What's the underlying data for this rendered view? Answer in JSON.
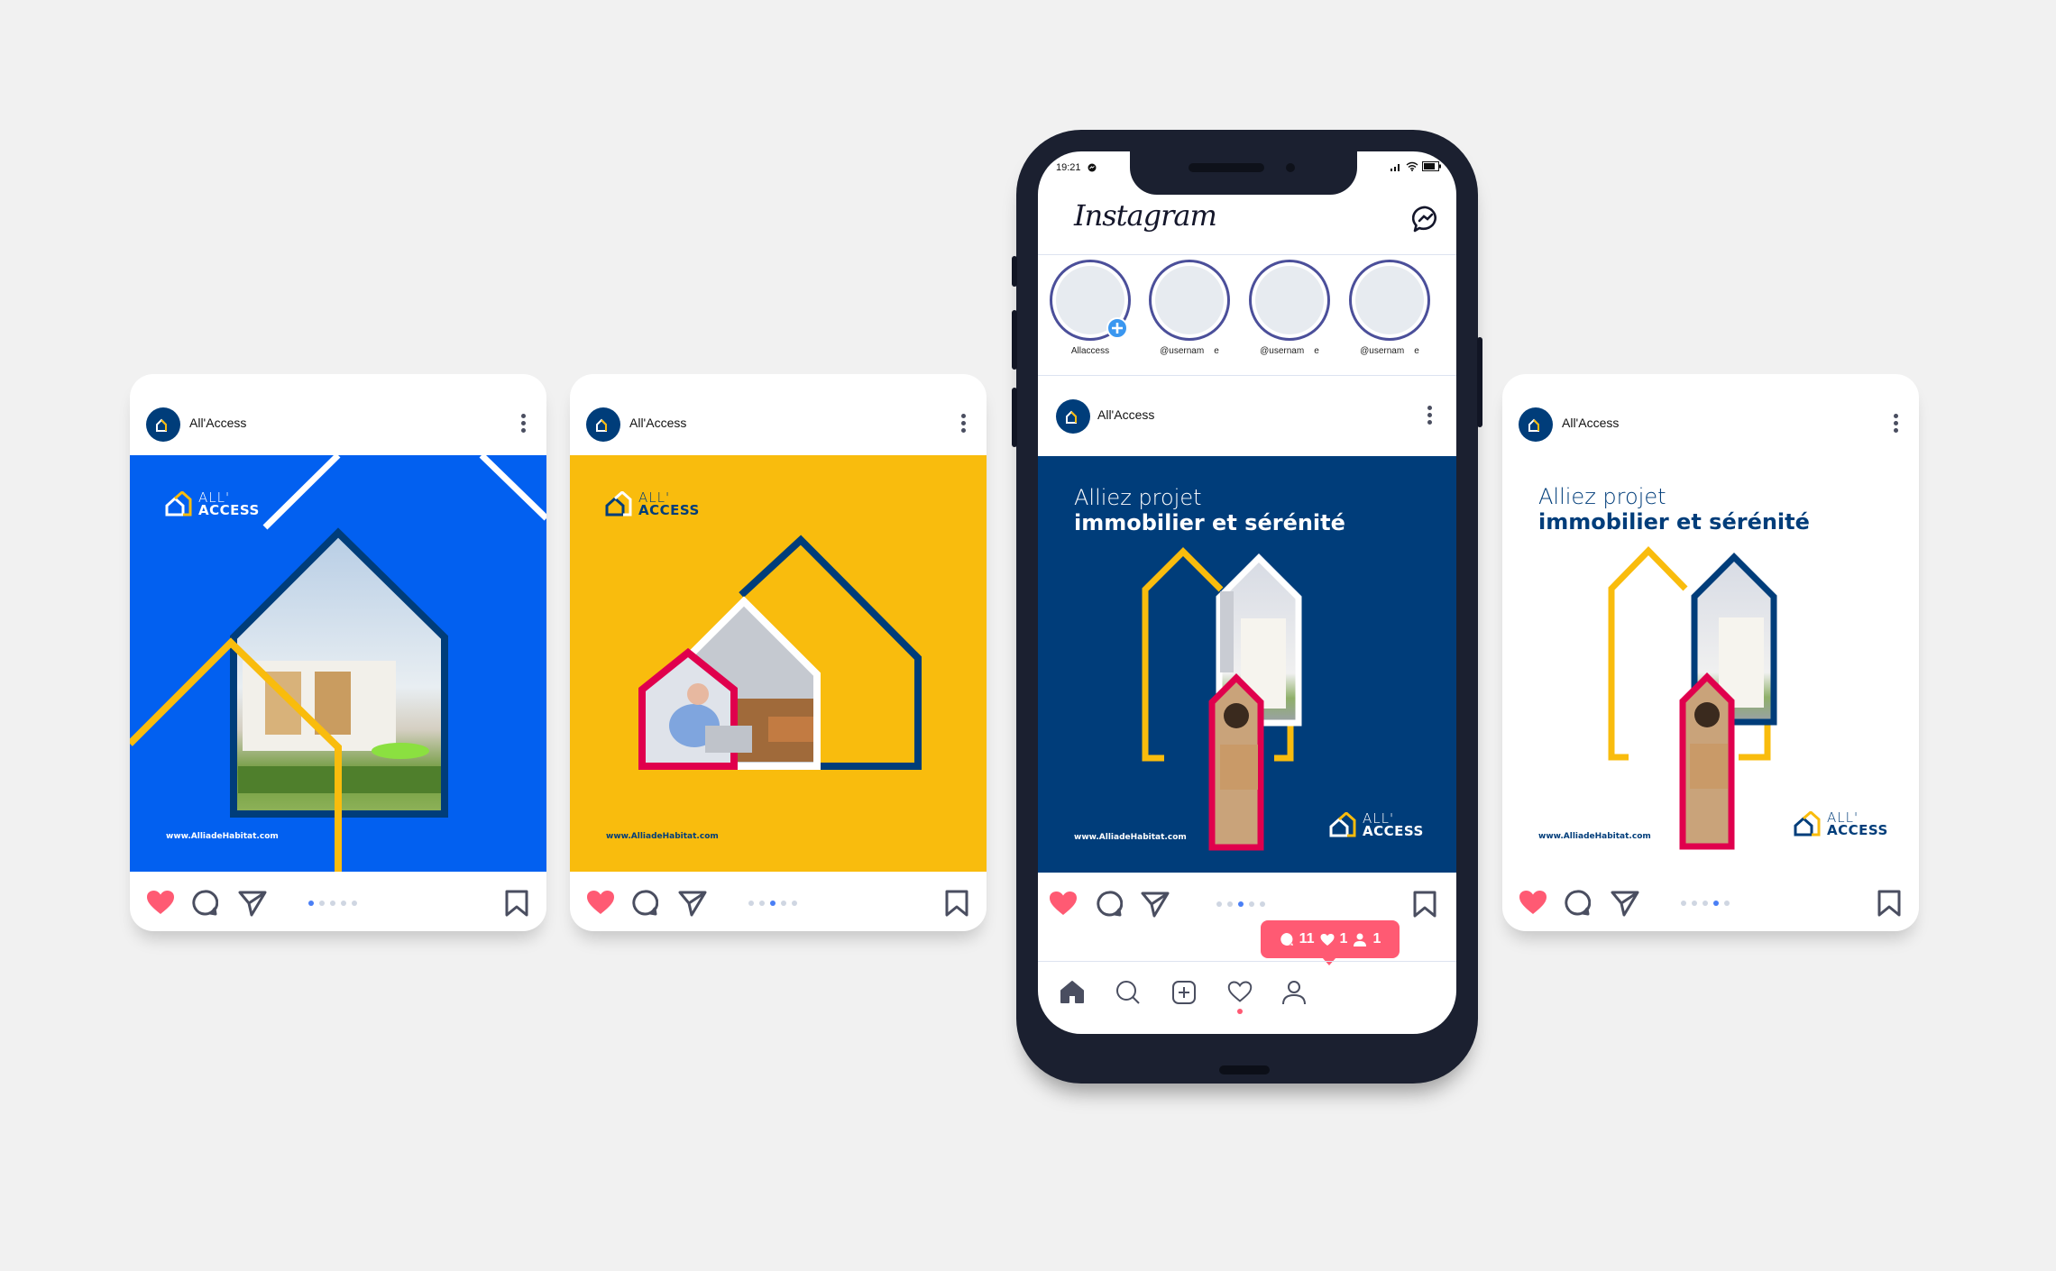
{
  "brand": {
    "account_name": "All'Access",
    "logo_line1": "ALL'",
    "logo_line2": "ACCESS",
    "website": "www.AlliadeHabitat.com",
    "headline_line1": "Alliez projet",
    "headline_line2": "immobilier et sérénité",
    "colors": {
      "navy": "#003d7a",
      "blue": "#0260f0",
      "yellow": "#f9bc0d",
      "red": "#e0004d",
      "like": "#ff5a73",
      "icon": "#4a4e60",
      "background": "#f1f1f1"
    }
  },
  "posts": [
    {
      "id": "post-blue",
      "background": "#0260f0",
      "active_dot": 0,
      "dot_count": 5,
      "theme": "blue"
    },
    {
      "id": "post-yellow",
      "background": "#f9bc0d",
      "active_dot": 2,
      "dot_count": 5,
      "theme": "yellow"
    },
    {
      "id": "post-phone-navy",
      "background": "#003d7a",
      "active_dot": 2,
      "dot_count": 5,
      "theme": "navy"
    },
    {
      "id": "post-white",
      "background": "#ffffff",
      "active_dot": 3,
      "dot_count": 5,
      "theme": "white"
    }
  ],
  "phone": {
    "status_time": "19:21",
    "app_title": "Instagram",
    "stories": [
      {
        "label": "Allaccess",
        "has_add": true
      },
      {
        "label": "@usernam    e",
        "has_add": false
      },
      {
        "label": "@usernam    e",
        "has_add": false
      },
      {
        "label": "@usernam    e",
        "has_add": false
      }
    ],
    "notification": {
      "comments": "11",
      "likes": "1",
      "followers": "1"
    },
    "nav_items": [
      "home",
      "search",
      "add",
      "activity",
      "profile"
    ]
  }
}
